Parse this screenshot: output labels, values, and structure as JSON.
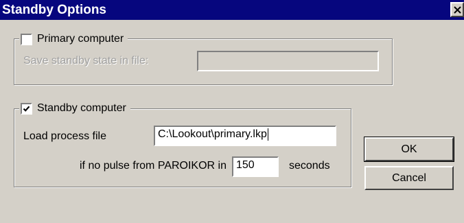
{
  "window": {
    "title": "Standby Options",
    "close_icon": "close-x-icon"
  },
  "primary": {
    "checkbox_label": "Primary computer",
    "checked": false,
    "save_state_label": "Save standby state in file:",
    "save_state_value": ""
  },
  "standby": {
    "checkbox_label": "Standby computer",
    "checked": true,
    "load_process_label": "Load process file",
    "load_process_value": "C:\\Lookout\\primary.lkp",
    "pulse_label": "if no pulse from PAROIKOR in",
    "pulse_value": "150",
    "seconds_label": "seconds"
  },
  "buttons": {
    "ok": "OK",
    "cancel": "Cancel"
  },
  "colors": {
    "titlebar": "#06067e",
    "face": "#d4d0c8"
  }
}
